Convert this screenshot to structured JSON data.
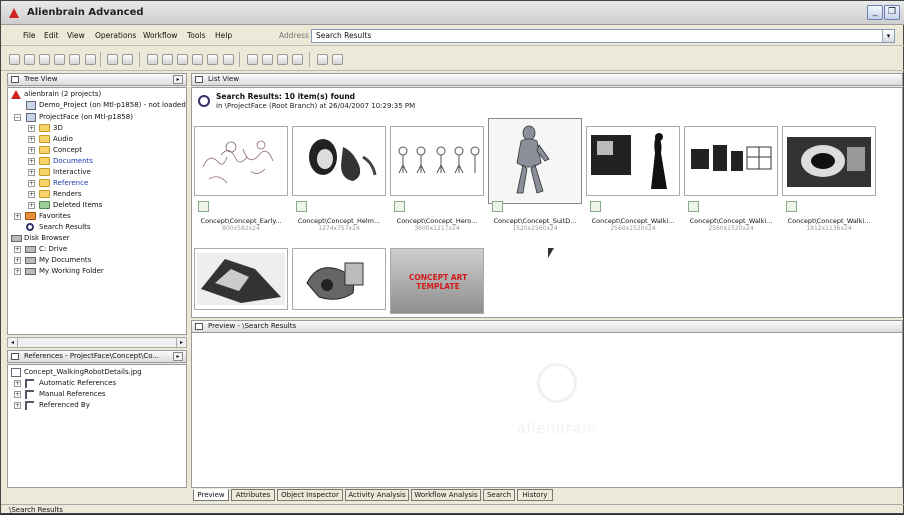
{
  "window": {
    "title": "Alienbrain Advanced",
    "controls": [
      "minimize-icon",
      "restore-icon"
    ]
  },
  "menu": [
    "File",
    "Edit",
    "View",
    "Operations",
    "Workflow",
    "Tools",
    "Help"
  ],
  "address": {
    "label": "Address",
    "value": "Search Results"
  },
  "tree_view": {
    "title": "Tree View",
    "nodes": [
      {
        "label": "alienbrain (2 projects)",
        "icon": "alienbrain-icon"
      },
      {
        "label": "Demo_Project (on Mtl-p1858) - not loaded",
        "icon": "project-icon"
      },
      {
        "label": "ProjectFace (on Mtl-p1858)",
        "icon": "project-icon"
      },
      {
        "label": "3D",
        "icon": "folder-icon"
      },
      {
        "label": "Audio",
        "icon": "folder-icon"
      },
      {
        "label": "Concept",
        "icon": "folder-icon"
      },
      {
        "label": "Documents",
        "icon": "folder-icon",
        "color": "#1d3fb0"
      },
      {
        "label": "Interactive",
        "icon": "folder-icon"
      },
      {
        "label": "Reference",
        "icon": "folder-icon",
        "color": "#1d3fb0"
      },
      {
        "label": "Renders",
        "icon": "folder-icon"
      },
      {
        "label": "Deleted Items",
        "icon": "folder-icon"
      },
      {
        "label": "Favorites",
        "icon": "favorites-icon"
      },
      {
        "label": "Search Results",
        "icon": "search-icon"
      },
      {
        "label": "Disk Browser",
        "icon": "disk-browser-icon"
      },
      {
        "label": "C: Drive",
        "icon": "drive-icon"
      },
      {
        "label": "My Documents",
        "icon": "drive-icon"
      },
      {
        "label": "My Working Folder",
        "icon": "drive-icon"
      }
    ]
  },
  "references": {
    "title": "References - ProjectFace\\Concept\\Co...",
    "nodes": [
      {
        "label": "Concept_WalkingRobotDetails.jpg",
        "icon": "file-icon"
      },
      {
        "label": "Automatic References",
        "icon": "reference-icon"
      },
      {
        "label": "Manual References",
        "icon": "reference-icon"
      },
      {
        "label": "Referenced By",
        "icon": "reference-icon"
      }
    ]
  },
  "list_view": {
    "title": "List View",
    "search_title": "Search Results:  10 item(s) found",
    "search_subtitle": "in \\ProjectFace (Root Branch) at 26/04/2007 10:29:35 PM",
    "items": [
      {
        "name": "Concept\\Concept_Early...",
        "dims": "800x582x24"
      },
      {
        "name": "Concept\\Concept_Helm...",
        "dims": "1274x757x24"
      },
      {
        "name": "Concept\\Concept_Hero...",
        "dims": "3600x1217x24"
      },
      {
        "name": "Concept\\Concept_SuitD...",
        "dims": "1520x2560x24"
      },
      {
        "name": "Concept\\Concept_Walki...",
        "dims": "2560x1520x24"
      },
      {
        "name": "Concept\\Concept_Walki...",
        "dims": "2560x1520x24"
      },
      {
        "name": "Concept\\Concept_Walki...",
        "dims": "1912x1136x24"
      },
      {
        "name": "",
        "dims": ""
      },
      {
        "name": "",
        "dims": ""
      },
      {
        "name": "",
        "dims": "",
        "overlay": "CONCEPT ART TEMPLATE"
      }
    ]
  },
  "preview": {
    "title": "Preview - \\Search Results",
    "logo_text": "alienbrain"
  },
  "tabs": [
    "Preview",
    "Attributes",
    "Object Inspector",
    "Activity Analysis",
    "Workflow Analysis",
    "Search",
    "History"
  ],
  "status": "\\Search Results"
}
